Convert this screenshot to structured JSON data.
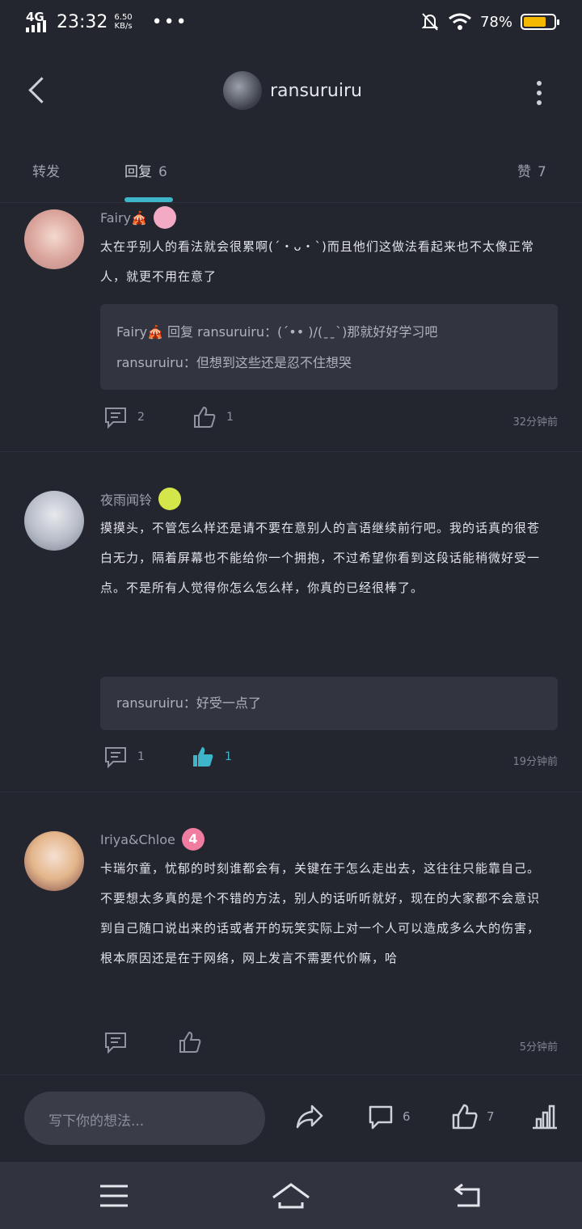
{
  "status": {
    "network": "4G",
    "time": "23:32",
    "speed_value": "6.50",
    "speed_unit": "KB/s",
    "more": "•••",
    "battery_pct": "78%",
    "battery_level": 0.78,
    "accent": "#f5b800"
  },
  "header": {
    "username": "ransuruiru"
  },
  "tabs": [
    {
      "label": "转发",
      "count": ""
    },
    {
      "label": "回复",
      "count": "6"
    },
    {
      "label": "赞",
      "count": "7"
    }
  ],
  "comments": [
    {
      "user": "Fairy🎪",
      "body": "太在乎别人的看法就会很累啊(´・ᴗ・`)而且他们这做法看起来也不太像正常人，就更不用在意了",
      "quote_lines": [
        "Fairy🎪 回复 ransuruiru：(´•• )/(ˍˍ`)那就好好学习吧",
        "ransuruiru：但想到这些还是忍不住想哭"
      ],
      "replies": "2",
      "likes": "1",
      "time": "32分钟前"
    },
    {
      "user": "夜雨闻铃",
      "body": "摸摸头，不管怎么样还是请不要在意别人的言语继续前行吧。我的话真的很苍白无力，隔着屏幕也不能给你一个拥抱，不过希望你看到这段话能稍微好受一点。不是所有人觉得你怎么怎么样，你真的已经很棒了。",
      "quote_lines": [
        "ransuruiru：好受一点了"
      ],
      "replies": "1",
      "likes": "1",
      "time": "19分钟前"
    },
    {
      "user": "Iriya&Chloe",
      "badge": "4",
      "body": "卡瑞尔童，忧郁的时刻谁都会有，关键在于怎么走出去，这往往只能靠自己。不要想太多真的是个不错的方法，别人的话听听就好，现在的大家都不会意识到自己随口说出来的话或者开的玩笑实际上对一个人可以造成多么大的伤害，根本原因还是在于网络，网上发言不需要代价嘛，哈",
      "replies": "",
      "likes": "",
      "time": "5分钟前"
    }
  ],
  "bottom": {
    "placeholder": "写下你的想法...",
    "comment_count": "6",
    "like_count": "7"
  },
  "colors": {
    "bg": "#23252f",
    "accent": "#3cb6c8",
    "quote_bg": "#32353f"
  }
}
